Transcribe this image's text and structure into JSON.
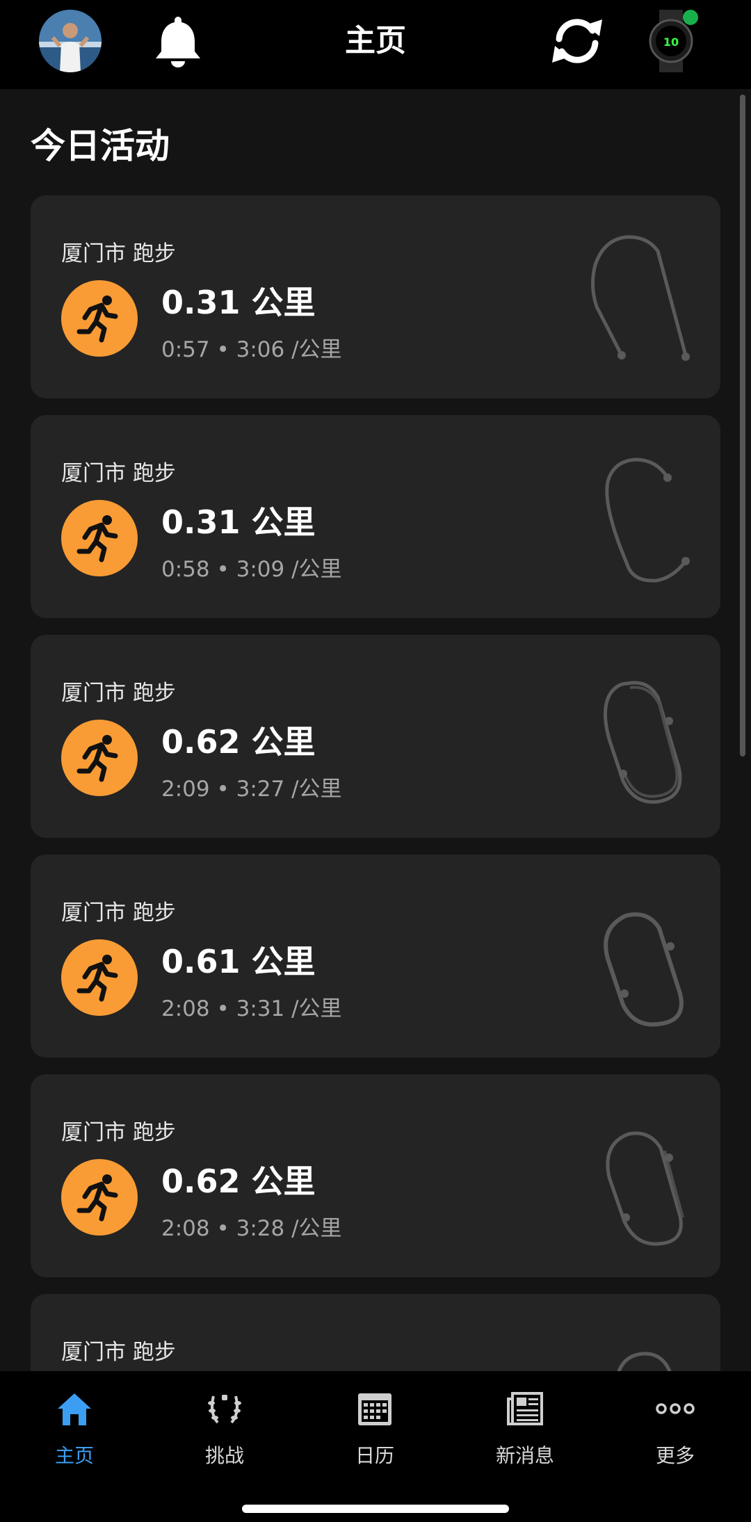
{
  "header": {
    "title": "主页",
    "watch_face_value": "10"
  },
  "section": {
    "title": "今日活动"
  },
  "activities": [
    {
      "location": "厦门市 跑步",
      "distance": "0.31 公里",
      "duration": "0:57",
      "pace": "3:06 /公里"
    },
    {
      "location": "厦门市 跑步",
      "distance": "0.31 公里",
      "duration": "0:58",
      "pace": "3:09 /公里"
    },
    {
      "location": "厦门市 跑步",
      "distance": "0.62 公里",
      "duration": "2:09",
      "pace": "3:27 /公里"
    },
    {
      "location": "厦门市 跑步",
      "distance": "0.61 公里",
      "duration": "2:08",
      "pace": "3:31 /公里"
    },
    {
      "location": "厦门市 跑步",
      "distance": "0.62 公里",
      "duration": "2:08",
      "pace": "3:28 /公里"
    },
    {
      "location": "厦门市 跑步"
    }
  ],
  "separator": "•",
  "nav": [
    {
      "label": "主页",
      "icon": "home-icon",
      "active": true
    },
    {
      "label": "挑战",
      "icon": "laurel-icon",
      "active": false
    },
    {
      "label": "日历",
      "icon": "calendar-icon",
      "active": false
    },
    {
      "label": "新消息",
      "icon": "news-icon",
      "active": false
    },
    {
      "label": "更多",
      "icon": "more-icon",
      "active": false
    }
  ],
  "colors": {
    "accent_orange": "#f99c35",
    "active_blue": "#3c9ef2",
    "card_bg": "#242424",
    "status_green": "#18b04a"
  }
}
